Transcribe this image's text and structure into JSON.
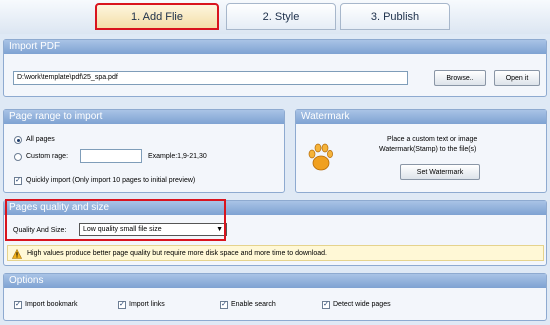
{
  "tabs": [
    {
      "label": "1. Add Flie"
    },
    {
      "label": "2. Style"
    },
    {
      "label": "3. Publish"
    }
  ],
  "import_pdf": {
    "title": "Import PDF",
    "path_value": "D:\\work\\template\\pdf\\25_spa.pdf",
    "browse_label": "Browse..",
    "open_label": "Open it"
  },
  "page_range": {
    "title": "Page range to import",
    "all_pages_label": "All pages",
    "custom_range_label": "Custom rage:",
    "custom_range_value": "",
    "example_text": "Example:1,9-21,30",
    "quick_import_label": "Quickly import (Only import 10 pages to  initial  preview)",
    "quick_import_checked": true
  },
  "watermark": {
    "title": "Watermark",
    "description_line1": "Place a custom text or image",
    "description_line2": "Watermark(Stamp) to the file(s)",
    "set_button_label": "Set Watermark"
  },
  "quality": {
    "title": "Pages quality and size",
    "field_label": "Quality And Size:",
    "selected": "Low quality small file size",
    "hint": "High values produce better page quality but require more disk space and more time to download."
  },
  "options": {
    "title": "Options",
    "items": [
      {
        "label": "Import bookmark",
        "checked": true
      },
      {
        "label": "Import links",
        "checked": true
      },
      {
        "label": "Enable search",
        "checked": true
      },
      {
        "label": "Detect wide pages",
        "checked": true
      }
    ]
  },
  "colors": {
    "panel_header": "#8fb0dc",
    "active_tab_outline": "#d9141e",
    "hint_background": "#fff8d6"
  }
}
